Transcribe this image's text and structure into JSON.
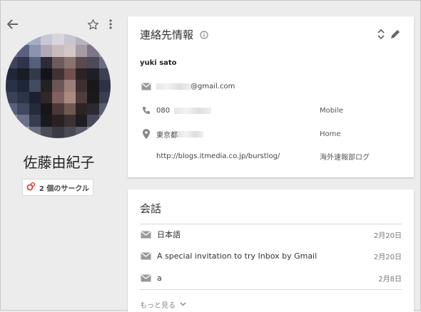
{
  "header": {
    "back_icon": "arrow-back",
    "star_icon": "star-outline",
    "menu_icon": "more-vert"
  },
  "profile": {
    "name": "佐藤由紀子",
    "circles_label": "2 個のサークル"
  },
  "contact_card": {
    "title": "連絡先情報",
    "display_name": "yuki sato",
    "email": "@gmail.com",
    "phone": "080",
    "phone_type": "Mobile",
    "address": "東京都",
    "address_type": "Home",
    "url": "http://blogs.itmedia.co.jp/burstlog/",
    "url_label": "海外速報部ログ"
  },
  "conversation_card": {
    "title": "会話",
    "items": [
      {
        "subject": "日本語",
        "date": "2月20日"
      },
      {
        "subject": "A special invitation to try Inbox by Gmail",
        "date": "2月20日"
      },
      {
        "subject": "a",
        "date": "2月8日"
      }
    ],
    "more_label": "もっと見る"
  },
  "colors": {
    "background": "#ececec",
    "card": "#ffffff",
    "circle_accent": "#e53935"
  }
}
